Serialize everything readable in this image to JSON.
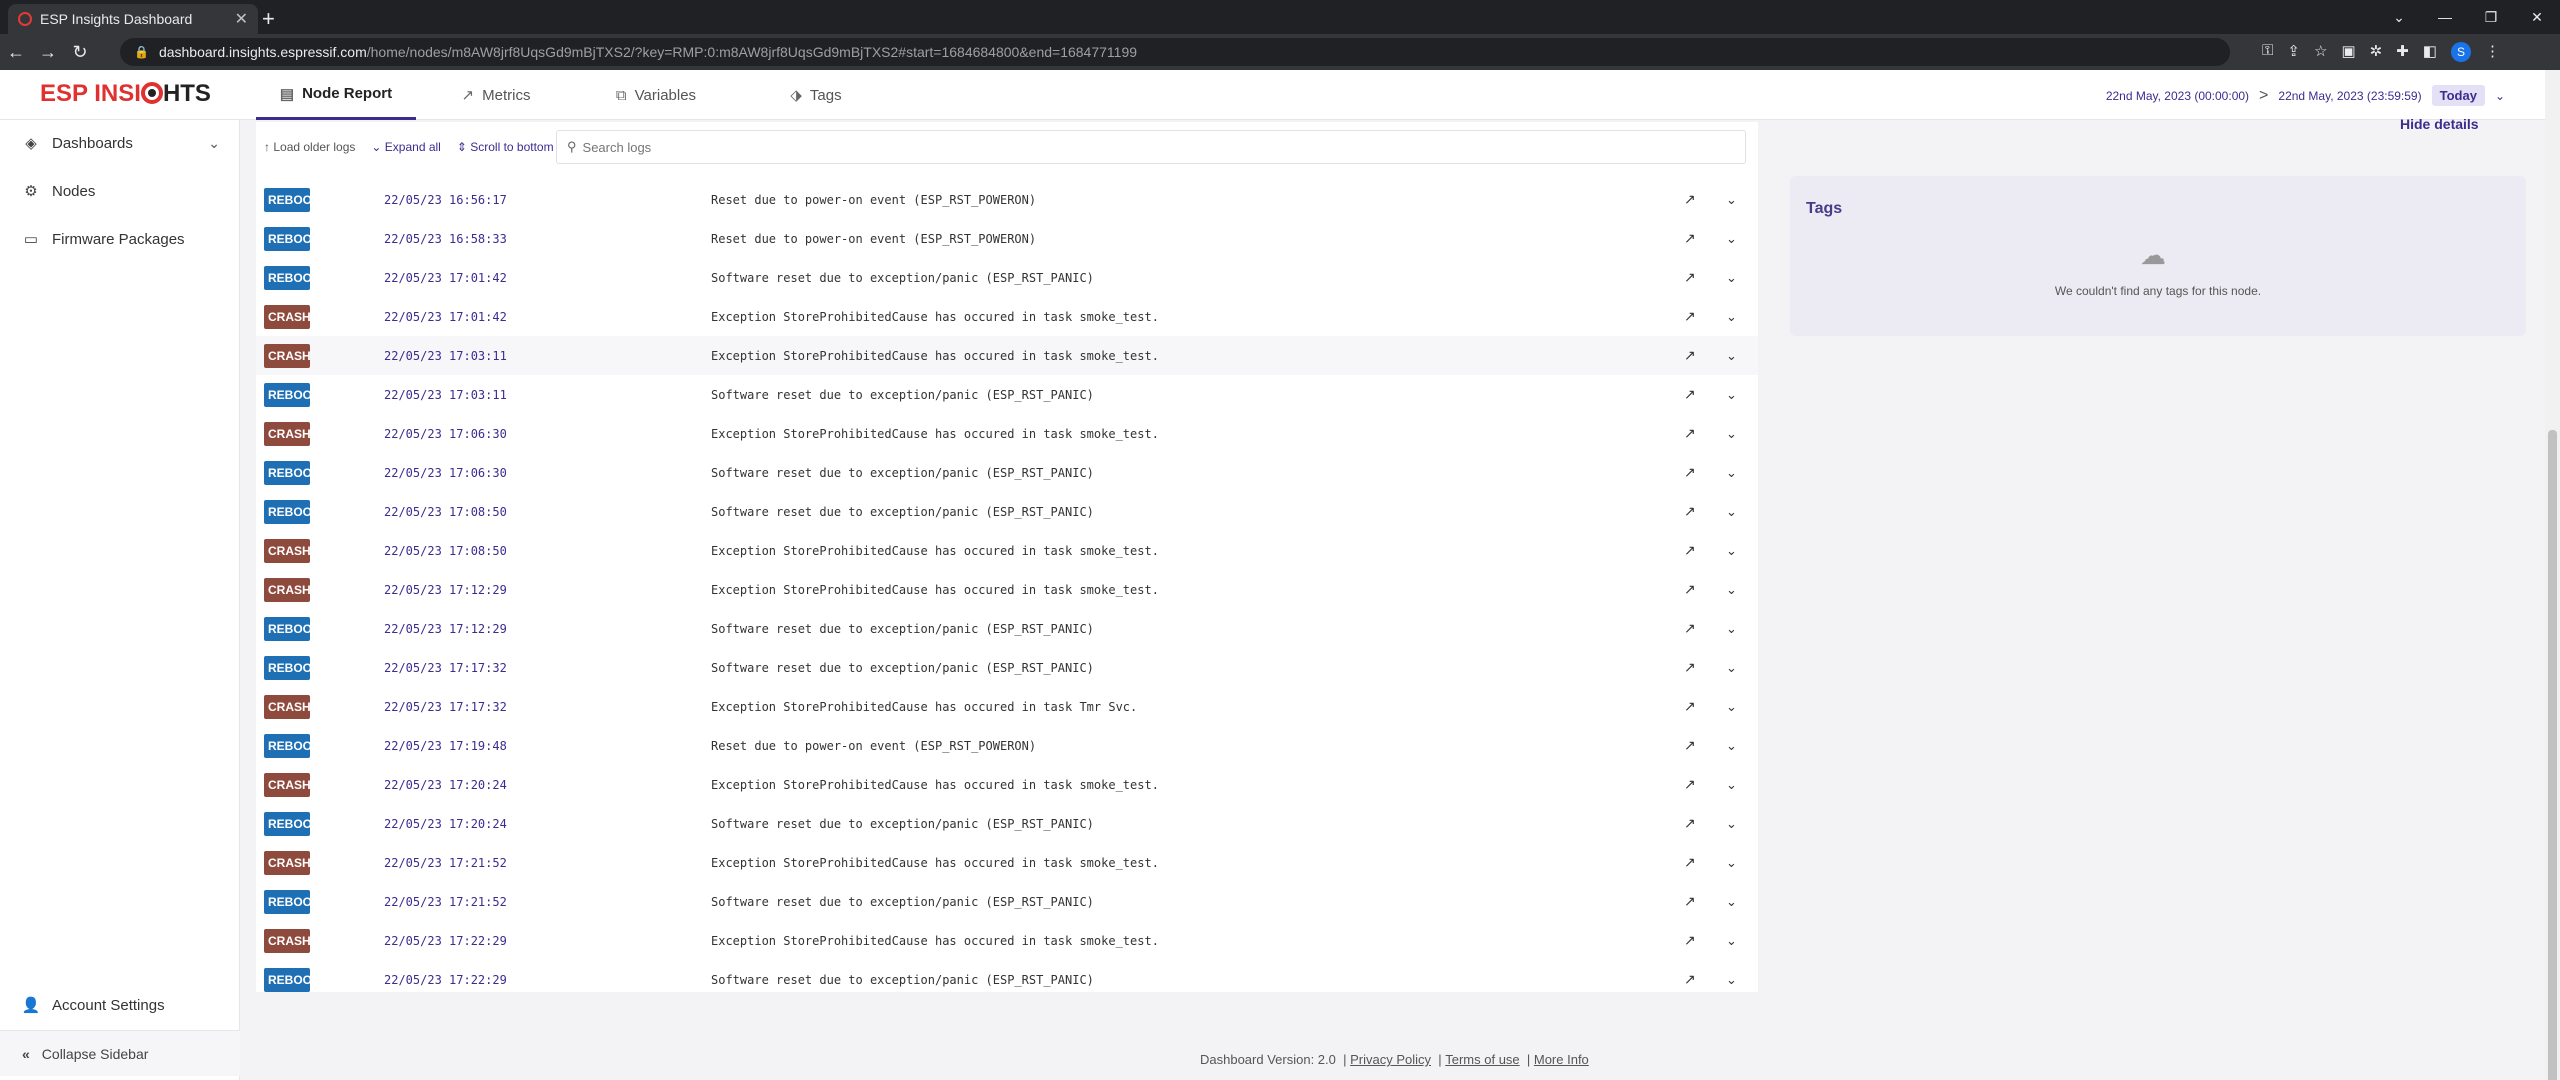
{
  "browser": {
    "tab_title": "ESP Insights Dashboard",
    "url_host": "dashboard.insights.espressif.com",
    "url_path": "/home/nodes/m8AW8jrf8UqsGd9mBjTXS2/?key=RMP:0:m8AW8jrf8UqsGd9mBjTXS2#start=1684684800&end=1684771199",
    "profile_initial": "S"
  },
  "header": {
    "logo_left": "ESP INSI",
    "logo_right": "HTS",
    "tabs": [
      {
        "label": "Node Report",
        "icon": "report-icon"
      },
      {
        "label": "Metrics",
        "icon": "trend-icon"
      },
      {
        "label": "Variables",
        "icon": "variables-icon"
      },
      {
        "label": "Tags",
        "icon": "tag-icon"
      }
    ],
    "date_start": "22nd May, 2023 (00:00:00)",
    "date_end": "22nd May, 2023 (23:59:59)",
    "today_label": "Today"
  },
  "sidebar": {
    "items": [
      {
        "label": "Dashboards",
        "icon": "layers-icon"
      },
      {
        "label": "Nodes",
        "icon": "gear-icon"
      },
      {
        "label": "Firmware Packages",
        "icon": "archive-icon"
      }
    ],
    "account_settings": "Account Settings",
    "collapse_label": "Collapse Sidebar"
  },
  "logs": {
    "toolbar": {
      "load_older": "Load older logs",
      "expand_all": "Expand all",
      "scroll_bottom": "Scroll to bottom",
      "search_placeholder": "Search logs"
    },
    "rows": [
      {
        "type": "reboot",
        "badge": "REBOOT",
        "ts": "22/05/23 16:56:17",
        "msg": "Reset due to power-on event (ESP_RST_POWERON)"
      },
      {
        "type": "reboot",
        "badge": "REBOOT",
        "ts": "22/05/23 16:58:33",
        "msg": "Reset due to power-on event (ESP_RST_POWERON)"
      },
      {
        "type": "reboot",
        "badge": "REBOOT",
        "ts": "22/05/23 17:01:42",
        "msg": "Software reset due to exception/panic (ESP_RST_PANIC)"
      },
      {
        "type": "crash",
        "badge": "CRASH",
        "ts": "22/05/23 17:01:42",
        "msg": "Exception StoreProhibitedCause has occured in task smoke_test."
      },
      {
        "type": "crash",
        "badge": "CRASH",
        "ts": "22/05/23 17:03:11",
        "msg": "Exception StoreProhibitedCause has occured in task smoke_test."
      },
      {
        "type": "reboot",
        "badge": "REBOOT",
        "ts": "22/05/23 17:03:11",
        "msg": "Software reset due to exception/panic (ESP_RST_PANIC)"
      },
      {
        "type": "crash",
        "badge": "CRASH",
        "ts": "22/05/23 17:06:30",
        "msg": "Exception StoreProhibitedCause has occured in task smoke_test."
      },
      {
        "type": "reboot",
        "badge": "REBOOT",
        "ts": "22/05/23 17:06:30",
        "msg": "Software reset due to exception/panic (ESP_RST_PANIC)"
      },
      {
        "type": "reboot",
        "badge": "REBOOT",
        "ts": "22/05/23 17:08:50",
        "msg": "Software reset due to exception/panic (ESP_RST_PANIC)"
      },
      {
        "type": "crash",
        "badge": "CRASH",
        "ts": "22/05/23 17:08:50",
        "msg": "Exception StoreProhibitedCause has occured in task smoke_test."
      },
      {
        "type": "crash",
        "badge": "CRASH",
        "ts": "22/05/23 17:12:29",
        "msg": "Exception StoreProhibitedCause has occured in task smoke_test."
      },
      {
        "type": "reboot",
        "badge": "REBOOT",
        "ts": "22/05/23 17:12:29",
        "msg": "Software reset due to exception/panic (ESP_RST_PANIC)"
      },
      {
        "type": "reboot",
        "badge": "REBOOT",
        "ts": "22/05/23 17:17:32",
        "msg": "Software reset due to exception/panic (ESP_RST_PANIC)"
      },
      {
        "type": "crash",
        "badge": "CRASH",
        "ts": "22/05/23 17:17:32",
        "msg": "Exception StoreProhibitedCause has occured in task Tmr Svc."
      },
      {
        "type": "reboot",
        "badge": "REBOOT",
        "ts": "22/05/23 17:19:48",
        "msg": "Reset due to power-on event (ESP_RST_POWERON)"
      },
      {
        "type": "crash",
        "badge": "CRASH",
        "ts": "22/05/23 17:20:24",
        "msg": "Exception StoreProhibitedCause has occured in task smoke_test."
      },
      {
        "type": "reboot",
        "badge": "REBOOT",
        "ts": "22/05/23 17:20:24",
        "msg": "Software reset due to exception/panic (ESP_RST_PANIC)"
      },
      {
        "type": "crash",
        "badge": "CRASH",
        "ts": "22/05/23 17:21:52",
        "msg": "Exception StoreProhibitedCause has occured in task smoke_test."
      },
      {
        "type": "reboot",
        "badge": "REBOOT",
        "ts": "22/05/23 17:21:52",
        "msg": "Software reset due to exception/panic (ESP_RST_PANIC)"
      },
      {
        "type": "crash",
        "badge": "CRASH",
        "ts": "22/05/23 17:22:29",
        "msg": "Exception StoreProhibitedCause has occured in task smoke_test."
      },
      {
        "type": "reboot",
        "badge": "REBOOT",
        "ts": "22/05/23 17:22:29",
        "msg": "Software reset due to exception/panic (ESP_RST_PANIC)"
      }
    ]
  },
  "details": {
    "hide_details": "Hide details",
    "tags_title": "Tags",
    "tags_empty": "We couldn't find any tags for this node."
  },
  "footer": {
    "version": "Dashboard Version: 2.0",
    "privacy": "Privacy Policy",
    "terms": "Terms of use",
    "more": "More Info"
  },
  "colors": {
    "brand": "#e03131",
    "accent": "#3b2d8f",
    "reboot_badge": "#1f6fb5",
    "crash_badge": "#8e4a3c"
  }
}
